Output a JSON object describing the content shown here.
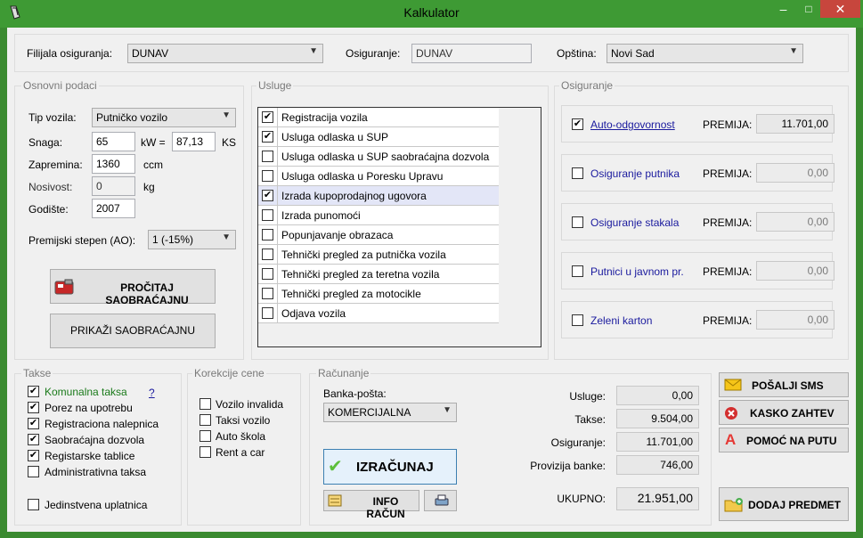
{
  "window": {
    "title": "Kalkulator",
    "minimize": "–",
    "maximize": "□",
    "close": "✕",
    "accent": "#3e9a34"
  },
  "top": {
    "filijala_label": "Filijala osiguranja:",
    "filijala_value": "DUNAV",
    "osiguranje_label": "Osiguranje:",
    "osiguranje_value": "DUNAV",
    "opstina_label": "Opština:",
    "opstina_value": "Novi Sad"
  },
  "osnovni": {
    "legend": "Osnovni podaci",
    "tip_label": "Tip vozila:",
    "tip_value": "Putničko vozilo",
    "snaga_label": "Snaga:",
    "snaga_value": "65",
    "kw_label": "kW =",
    "ks_value": "87,13",
    "ks_label": "KS",
    "zapremina_label": "Zapremina:",
    "zapremina_value": "1360",
    "ccm_label": "ccm",
    "nosivost_label": "Nosivost:",
    "nosivost_value": "0",
    "kg_label": "kg",
    "godiste_label": "Godište:",
    "godiste_value": "2007",
    "premijski_label": "Premijski stepen (AO):",
    "premijski_value": "1 (-15%)",
    "procitaj_label": "PROČITAJ SAOBRAĆAJNU",
    "prikazi_label": "PRIKAŽI SAOBRAĆAJNU"
  },
  "usluge": {
    "legend": "Usluge",
    "items": [
      {
        "label": "Registracija vozila",
        "checked": true,
        "mark": "✔"
      },
      {
        "label": "Usluga odlaska u SUP",
        "checked": true,
        "mark": "✔"
      },
      {
        "label": "Usluga odlaska u SUP saobraćajna dozvola",
        "checked": false,
        "mark": ""
      },
      {
        "label": "Usluga odlaska u Poresku Upravu",
        "checked": false,
        "mark": ""
      },
      {
        "label": "Izrada kupoprodajnog ugovora",
        "checked": true,
        "mark": "✔"
      },
      {
        "label": "Izrada punomoći",
        "checked": false,
        "mark": ""
      },
      {
        "label": "Popunjavanje obrazaca",
        "checked": false,
        "mark": ""
      },
      {
        "label": "Tehnički pregled za putnička vozila",
        "checked": false,
        "mark": ""
      },
      {
        "label": "Tehnički pregled za teretna vozila",
        "checked": false,
        "mark": ""
      },
      {
        "label": "Tehnički pregled za motocikle",
        "checked": false,
        "mark": ""
      },
      {
        "label": "Odjava vozila",
        "checked": false,
        "mark": ""
      }
    ]
  },
  "osiguranje": {
    "legend": "Osiguranje",
    "premija_label": "PREMIJA:",
    "items": [
      {
        "label": "Auto-odgovornost",
        "checked": true,
        "mark": "✔",
        "value": "11.701,00"
      },
      {
        "label": "Osiguranje putnika",
        "checked": false,
        "mark": "",
        "value": "0,00"
      },
      {
        "label": "Osiguranje stakala",
        "checked": false,
        "mark": "",
        "value": "0,00"
      },
      {
        "label": "Putnici u javnom pr.",
        "checked": false,
        "mark": "",
        "value": "0,00"
      },
      {
        "label": "Zeleni karton",
        "checked": false,
        "mark": "",
        "value": "0,00"
      }
    ]
  },
  "takse": {
    "legend": "Takse",
    "help": "?",
    "items": [
      {
        "label": "Komunalna taksa",
        "checked": true,
        "mark": "✔"
      },
      {
        "label": "Porez na upotrebu",
        "checked": true,
        "mark": "✔"
      },
      {
        "label": "Registraciona nalepnica",
        "checked": true,
        "mark": "✔"
      },
      {
        "label": "Saobraćajna dozvola",
        "checked": true,
        "mark": "✔"
      },
      {
        "label": "Registarske tablice",
        "checked": true,
        "mark": "✔"
      },
      {
        "label": "Administrativna taksa",
        "checked": false,
        "mark": ""
      }
    ],
    "jedinstvena": "Jedinstvena uplatnica"
  },
  "korekcije": {
    "legend": "Korekcije cene",
    "items": [
      {
        "label": "Vozilo invalida",
        "mark": ""
      },
      {
        "label": "Taksi vozilo",
        "mark": ""
      },
      {
        "label": "Auto škola",
        "mark": ""
      },
      {
        "label": "Rent a car",
        "mark": ""
      }
    ]
  },
  "racunanje": {
    "legend": "Računanje",
    "banka_label": "Banka-pošta:",
    "banka_value": "KOMERCIJALNA",
    "izracunaj_label": "IZRAČUNAJ",
    "info_label": "INFO RAČUN",
    "usluge_label": "Usluge:",
    "usluge_value": "0,00",
    "takse_label": "Takse:",
    "takse_value": "9.504,00",
    "osiguranje_label": "Osiguranje:",
    "osiguranje_value": "11.701,00",
    "provizija_label": "Provizija banke:",
    "provizija_value": "746,00",
    "ukupno_label": "UKUPNO:",
    "ukupno_value": "21.951,00"
  },
  "actions": {
    "sms_label": "POŠALJI SMS",
    "kasko_label": "KASKO ZAHTEV",
    "pomoc_label": "POMOĆ NA PUTU",
    "dodaj_label": "DODAJ PREDMET"
  }
}
